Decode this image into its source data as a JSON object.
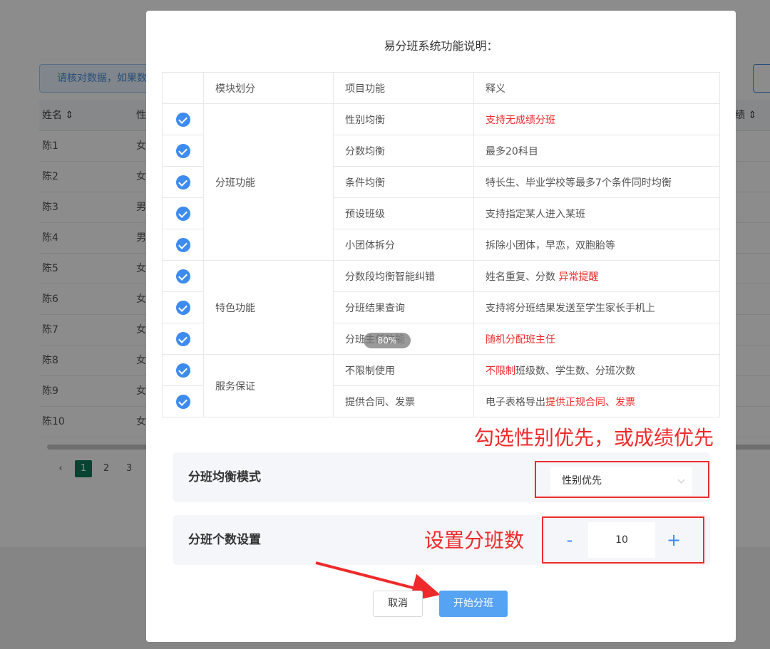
{
  "background": {
    "notice_text": "请核对数据，如果数",
    "table_headers": [
      "姓名 ⇕",
      "性",
      "绩 ⇕"
    ],
    "rows": [
      {
        "name": "陈1",
        "gender": "女"
      },
      {
        "name": "陈2",
        "gender": "女"
      },
      {
        "name": "陈3",
        "gender": "男"
      },
      {
        "name": "陈4",
        "gender": "男"
      },
      {
        "name": "陈5",
        "gender": "女"
      },
      {
        "name": "陈6",
        "gender": "女"
      },
      {
        "name": "陈7",
        "gender": "女"
      },
      {
        "name": "陈8",
        "gender": "女"
      },
      {
        "name": "陈9",
        "gender": "女"
      },
      {
        "name": "陈10",
        "gender": "女"
      }
    ],
    "pager": {
      "prev": "‹",
      "pages": [
        "1",
        "2",
        "3",
        "..."
      ],
      "active": "1"
    }
  },
  "modal": {
    "title": "易分班系统功能说明：",
    "table": {
      "headers": [
        "模块划分",
        "项目功能",
        "释义"
      ],
      "groups": [
        {
          "module": "分班功能",
          "items": [
            {
              "feature": "性别均衡",
              "desc_plain": "",
              "desc_red": "支持无成绩分班",
              "desc_tail": ""
            },
            {
              "feature": "分数均衡",
              "desc_plain": "最多20科目",
              "desc_red": "",
              "desc_tail": ""
            },
            {
              "feature": "条件均衡",
              "desc_plain": "特长生、毕业学校等最多7个条件同时均衡",
              "desc_red": "",
              "desc_tail": ""
            },
            {
              "feature": "预设班级",
              "desc_plain": "支持指定某人进入某班",
              "desc_red": "",
              "desc_tail": ""
            },
            {
              "feature": "小团体拆分",
              "desc_plain": "拆除小团体，早恋，双胞胎等",
              "desc_red": "",
              "desc_tail": ""
            }
          ]
        },
        {
          "module": "特色功能",
          "items": [
            {
              "feature": "分数段均衡智能纠错",
              "desc_plain": "姓名重复、分数 ",
              "desc_red": "异常提醒",
              "desc_tail": ""
            },
            {
              "feature": "分班结果查询",
              "desc_plain": "支持将分班结果发送至学生家长手机上",
              "desc_red": "",
              "desc_tail": ""
            },
            {
              "feature": "分班主任功能",
              "desc_plain": "",
              "desc_red": "随机分配班主任",
              "desc_tail": ""
            }
          ]
        },
        {
          "module": "服务保证",
          "items": [
            {
              "feature": "不限制使用",
              "desc_plain": "",
              "desc_red": "不限制",
              "desc_tail": "班级数、学生数、分班次数"
            },
            {
              "feature": "提供合同、发票",
              "desc_plain": "电子表格导出",
              "desc_red": "提供正规合同、发票",
              "desc_tail": ""
            }
          ]
        }
      ]
    },
    "zoom_badge": "80%",
    "annotation_mode": "勾选性别优先，或成绩优先",
    "annotation_count": "设置分班数",
    "mode_label": "分班均衡模式",
    "mode_value": "性别优先",
    "count_label": "分班个数设置",
    "count_value": "10",
    "minus": "-",
    "plus": "+",
    "cancel_label": "取消",
    "start_label": "开始分班"
  },
  "colors": {
    "accent": "#3d8bef",
    "annotation": "#ef2a2a",
    "primary_button": "#57a3f3"
  }
}
